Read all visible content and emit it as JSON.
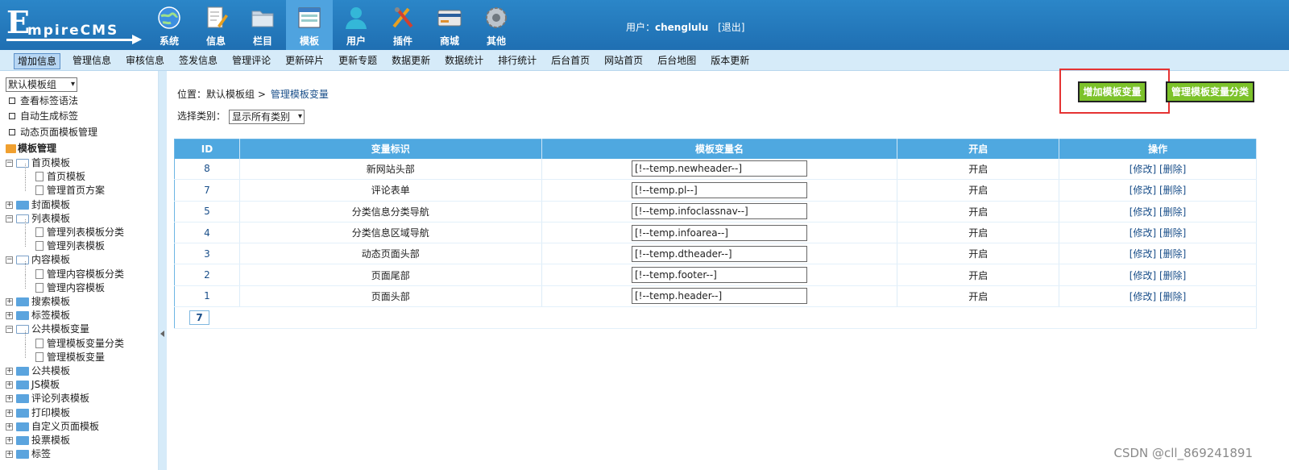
{
  "header": {
    "logo_initial": "E",
    "logo_rest": "mpireCMS",
    "nav": [
      {
        "label": "系统",
        "icon": "globe-icon",
        "active": false
      },
      {
        "label": "信息",
        "icon": "document-edit-icon",
        "active": false
      },
      {
        "label": "栏目",
        "icon": "folder-icon",
        "active": false
      },
      {
        "label": "模板",
        "icon": "template-window-icon",
        "active": true
      },
      {
        "label": "用户",
        "icon": "user-icon",
        "active": false
      },
      {
        "label": "插件",
        "icon": "tools-icon",
        "active": false
      },
      {
        "label": "商城",
        "icon": "credit-card-icon",
        "active": false
      },
      {
        "label": "其他",
        "icon": "gear-icon",
        "active": false
      }
    ],
    "user_label": "用户：",
    "username": "chenglulu",
    "logout": "[退出]"
  },
  "submenu": {
    "items": [
      "增加信息",
      "管理信息",
      "审核信息",
      "签发信息",
      "管理评论",
      "更新碎片",
      "更新专题",
      "数据更新",
      "数据统计",
      "排行统计",
      "后台首页",
      "网站首页",
      "后台地图",
      "版本更新"
    ],
    "active_index": 0
  },
  "sidebar": {
    "group_select": "默认模板组",
    "links": [
      "查看标签语法",
      "自动生成标签",
      "动态页面模板管理"
    ],
    "tree_root": "模板管理",
    "tree": [
      {
        "label": "首页模板",
        "level": 0,
        "type": "open"
      },
      {
        "label": "首页模板",
        "level": 1,
        "type": "page"
      },
      {
        "label": "管理首页方案",
        "level": 1,
        "type": "page"
      },
      {
        "label": "封面模板",
        "level": 0,
        "type": "closed"
      },
      {
        "label": "列表模板",
        "level": 0,
        "type": "open"
      },
      {
        "label": "管理列表模板分类",
        "level": 1,
        "type": "page"
      },
      {
        "label": "管理列表模板",
        "level": 1,
        "type": "page"
      },
      {
        "label": "内容模板",
        "level": 0,
        "type": "open"
      },
      {
        "label": "管理内容模板分类",
        "level": 1,
        "type": "page"
      },
      {
        "label": "管理内容模板",
        "level": 1,
        "type": "page"
      },
      {
        "label": "搜索模板",
        "level": 0,
        "type": "closed"
      },
      {
        "label": "标签模板",
        "level": 0,
        "type": "closed"
      },
      {
        "label": "公共模板变量",
        "level": 0,
        "type": "open"
      },
      {
        "label": "管理模板变量分类",
        "level": 1,
        "type": "page"
      },
      {
        "label": "管理模板变量",
        "level": 1,
        "type": "page"
      },
      {
        "label": "公共模板",
        "level": 0,
        "type": "closed"
      },
      {
        "label": "JS模板",
        "level": 0,
        "type": "closed"
      },
      {
        "label": "评论列表模板",
        "level": 0,
        "type": "closed"
      },
      {
        "label": "打印模板",
        "level": 0,
        "type": "closed"
      },
      {
        "label": "自定义页面模板",
        "level": 0,
        "type": "closed"
      },
      {
        "label": "投票模板",
        "level": 0,
        "type": "closed"
      },
      {
        "label": "标签",
        "level": 0,
        "type": "closed"
      }
    ]
  },
  "content": {
    "breadcrumb_prefix": "位置：默认模板组 >",
    "breadcrumb_current": "管理模板变量",
    "filter_label": "选择类别：",
    "filter_value": "显示所有类别",
    "btn_add": "增加模板变量",
    "btn_manage_cat": "管理模板变量分类",
    "columns": [
      "ID",
      "变量标识",
      "模板变量名",
      "开启",
      "操作"
    ],
    "rows": [
      {
        "id": "8",
        "ident": "新网站头部",
        "var": "[!--temp.newheader--]",
        "on": "开启",
        "edit": "[修改]",
        "del": "[删除]"
      },
      {
        "id": "7",
        "ident": "评论表单",
        "var": "[!--temp.pl--]",
        "on": "开启",
        "edit": "[修改]",
        "del": "[删除]"
      },
      {
        "id": "5",
        "ident": "分类信息分类导航",
        "var": "[!--temp.infoclassnav--]",
        "on": "开启",
        "edit": "[修改]",
        "del": "[删除]"
      },
      {
        "id": "4",
        "ident": "分类信息区域导航",
        "var": "[!--temp.infoarea--]",
        "on": "开启",
        "edit": "[修改]",
        "del": "[删除]"
      },
      {
        "id": "3",
        "ident": "动态页面头部",
        "var": "[!--temp.dtheader--]",
        "on": "开启",
        "edit": "[修改]",
        "del": "[删除]"
      },
      {
        "id": "2",
        "ident": "页面尾部",
        "var": "[!--temp.footer--]",
        "on": "开启",
        "edit": "[修改]",
        "del": "[删除]"
      },
      {
        "id": "1",
        "ident": "页面头部",
        "var": "[!--temp.header--]",
        "on": "开启",
        "edit": "[修改]",
        "del": "[删除]"
      }
    ],
    "page_count": "7"
  },
  "watermark": "CSDN @cll_869241891",
  "colors": {
    "header_blue": "#1f6fb2",
    "active_tab": "#4fa3df",
    "table_head": "#4fa8e0",
    "green_button": "#7cc22a",
    "highlight_red": "#e53333"
  }
}
